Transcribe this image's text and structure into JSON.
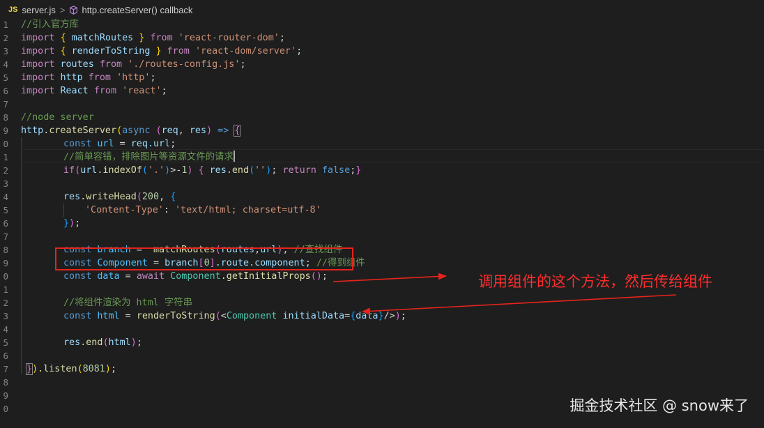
{
  "breadcrumb": {
    "lang_badge": "JS",
    "file": "server.js",
    "sep": ">",
    "symbol": "http.createServer() callback"
  },
  "line_numbers": [
    "1",
    "2",
    "3",
    "4",
    "5",
    "6",
    "7",
    "8",
    "9",
    "0",
    "1",
    "2",
    "3",
    "4",
    "5",
    "6",
    "7",
    "8",
    "9",
    "0",
    "1",
    "2",
    "3",
    "4",
    "5",
    "6",
    "7",
    "8",
    "9",
    "0"
  ],
  "code": {
    "l1_comment": "//引入官方库",
    "l2": {
      "kw": "import",
      "o": "{",
      "name": "matchRoutes",
      "c": "}",
      "from": "from",
      "str": "'react-router-dom'",
      "semi": ";"
    },
    "l3": {
      "kw": "import",
      "o": "{",
      "name": "renderToString",
      "c": "}",
      "from": "from",
      "str": "'react-dom/server'",
      "semi": ";"
    },
    "l4": {
      "kw": "import",
      "name": "routes",
      "from": "from",
      "str": "'./routes-config.js'",
      "semi": ";"
    },
    "l5": {
      "kw": "import",
      "name": "http",
      "from": "from",
      "str": "'http'",
      "semi": ";"
    },
    "l6": {
      "kw": "import",
      "name": "React",
      "from": "from",
      "str": "'react'",
      "semi": ";"
    },
    "l8_comment": "//node server",
    "l9": {
      "obj": "http",
      "dot": ".",
      "fn": "createServer",
      "p1": "(",
      "async": "async",
      "p2": "(",
      "req": "req",
      "comma": ", ",
      "res": "res",
      "p3": ")",
      "arrow": " => ",
      "brace": "{"
    },
    "l10": {
      "const": "const",
      "var": "url",
      "eq": " = ",
      "obj": "req",
      "prop": ".url",
      "semi": ";"
    },
    "l11_comment": "//简单容错，排除图片等资源文件的请求",
    "l12": {
      "if": "if",
      "p1": "(",
      "obj": "url",
      "fn": ".indexOf",
      "p2": "(",
      "str": "'.'",
      "p3": ")",
      "op": ">-",
      "num": "1",
      "p4": ")",
      "sp": " ",
      "b1": "{",
      "res": " res",
      "fn2": ".end",
      "p5": "(",
      "str2": "''",
      "p6": ")",
      "semi": "; ",
      "ret": "return",
      "fal": " false",
      "semi2": ";",
      "b2": "}"
    },
    "l14": {
      "obj": "res",
      "fn": ".writeHead",
      "p1": "(",
      "num": "200",
      "comma": ", ",
      "b": "{"
    },
    "l15": {
      "key": "'Content-Type'",
      "colon": ": ",
      "val": "'text/html; charset=utf-8'"
    },
    "l16": {
      "b": "}",
      "p": ")",
      "semi": ";"
    },
    "l18": {
      "const": "const",
      "var": "branch",
      "eq": " =  ",
      "fn": "matchRoutes",
      "p1": "(",
      "a1": "routes",
      "comma": ",",
      "a2": "url",
      "p2": ")",
      "semi": "; ",
      "comment": "//查找组件"
    },
    "l19": {
      "const": "const",
      "var": "Component",
      "eq": " = ",
      "obj": "branch",
      "b1": "[",
      "num": "0",
      "b2": "]",
      "p1": ".route",
      "p2": ".component",
      "semi": "; ",
      "comment": "//得到组件"
    },
    "l20": {
      "const": "const",
      "var": "data",
      "eq": " = ",
      "await": "await",
      "cls": " Component",
      "fn": ".getInitialProps",
      "p": "()",
      "semi": ";"
    },
    "l22_comment": "//将组件渲染为 html 字符串",
    "l23": {
      "const": "const",
      "var": "html",
      "eq": " = ",
      "fn": "renderToString",
      "p1": "(",
      "lt": "<",
      "cmp": "Component",
      "attr": " initialData",
      "eq2": "=",
      "b1": "{",
      "data": "data",
      "b2": "}",
      "end": "/>",
      "p2": ")",
      "semi": ";"
    },
    "l25": {
      "obj": "res",
      "fn": ".end",
      "p1": "(",
      "arg": "html",
      "p2": ")",
      "semi": ";"
    },
    "l27": {
      "b": "}",
      "p": ")",
      "fn": ".listen",
      "p1": "(",
      "num": "8081",
      "p2": ")",
      "semi": ";"
    }
  },
  "annotation_text": "调用组件的这个方法，然后传给组件",
  "watermark": "掘金技术社区 @ snow来了",
  "colors": {
    "background": "#1e1e1e",
    "annotation_red": "#e8231b"
  }
}
